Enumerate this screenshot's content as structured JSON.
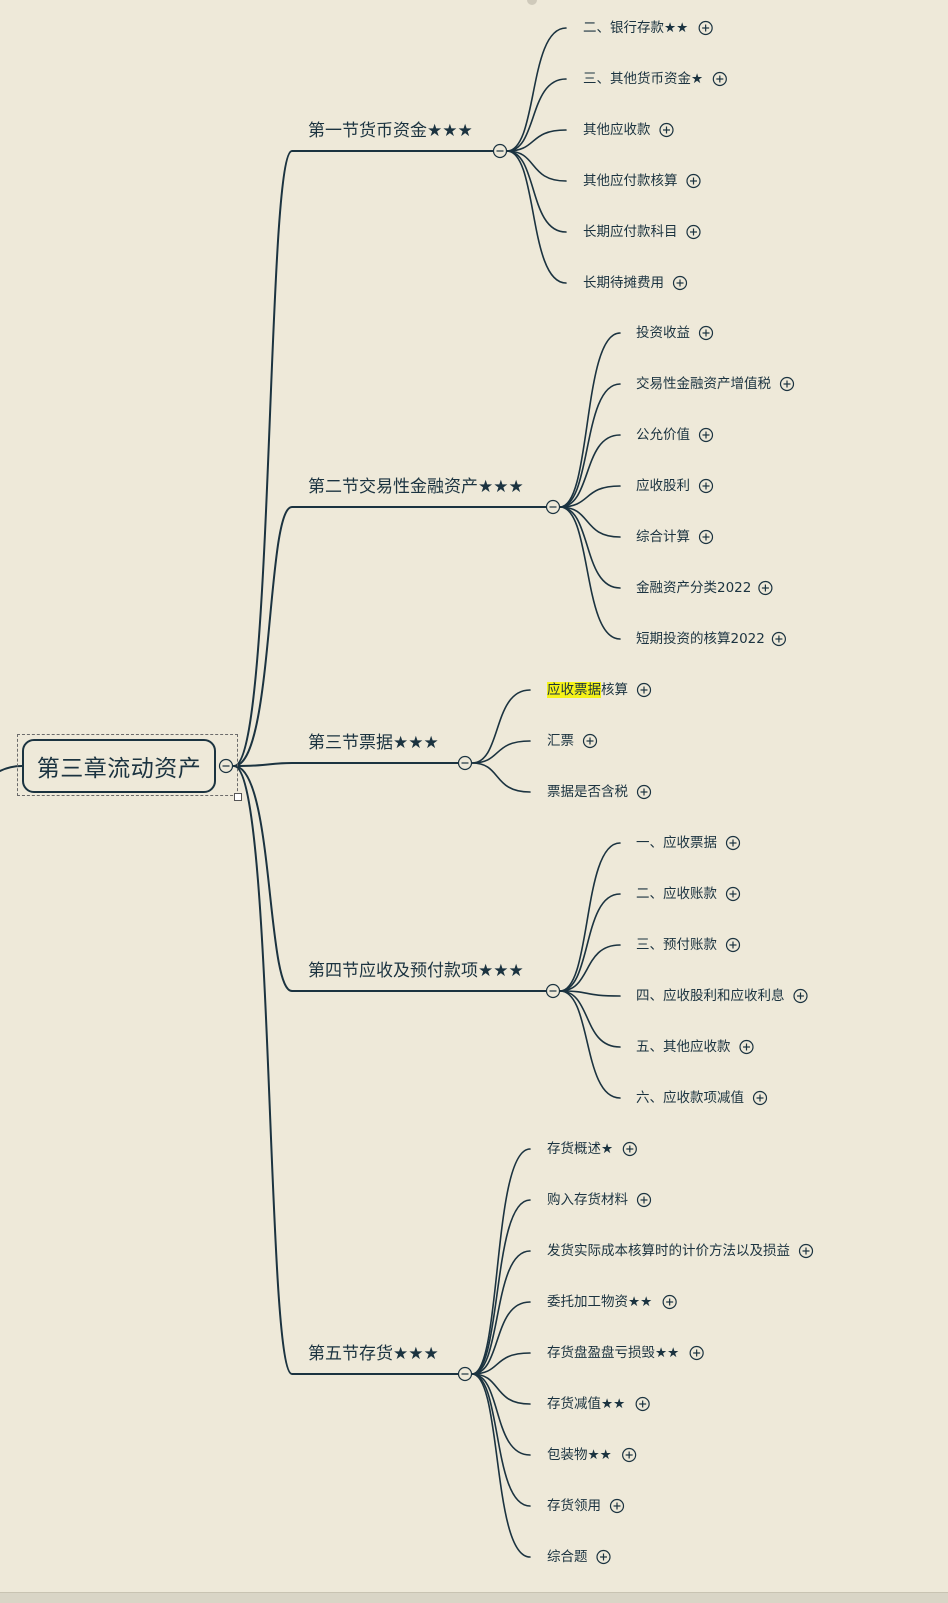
{
  "root": {
    "label": "第三章流动资产"
  },
  "sections": [
    {
      "label": "第一节货币资金★★★",
      "hl": "",
      "children": [
        {
          "label": "二、银行存款★★"
        },
        {
          "label": "三、其他货币资金★"
        },
        {
          "label": "其他应收款"
        },
        {
          "label": "其他应付款核算"
        },
        {
          "label": "长期应付款科目"
        },
        {
          "label": "长期待摊费用"
        }
      ]
    },
    {
      "label": "第二节交易性金融资产★★★",
      "children": [
        {
          "label": "投资收益"
        },
        {
          "label": "交易性金融资产增值税"
        },
        {
          "label": "公允价值"
        },
        {
          "label": "应收股利"
        },
        {
          "label": "综合计算"
        },
        {
          "label": "金融资产分类2022"
        },
        {
          "label": "短期投资的核算2022"
        }
      ]
    },
    {
      "label": "第三节票据★★★",
      "children": [
        {
          "label": "核算",
          "highlight": "应收票据"
        },
        {
          "label": "汇票"
        },
        {
          "label": "票据是否含税"
        }
      ]
    },
    {
      "label": "第四节应收及预付款项★★★",
      "children": [
        {
          "label": "一、应收票据"
        },
        {
          "label": "二、应收账款"
        },
        {
          "label": "三、预付账款"
        },
        {
          "label": "四、应收股利和应收利息"
        },
        {
          "label": "五、其他应收款"
        },
        {
          "label": "六、应收款项减值"
        }
      ]
    },
    {
      "label": "第五节存货★★★",
      "children": [
        {
          "label": "存货概述★"
        },
        {
          "label": "购入存货材料"
        },
        {
          "label": "发货实际成本核算时的计价方法以及损益"
        },
        {
          "label": "委托加工物资★★"
        },
        {
          "label": "存货盘盈盘亏损毁★★"
        },
        {
          "label": "存货减值★★"
        },
        {
          "label": "包装物★★"
        },
        {
          "label": "存货领用"
        },
        {
          "label": "综合题"
        }
      ]
    }
  ],
  "colors": {
    "line": "#1b3340",
    "background": "#eee9d9",
    "highlight": "#f5f21a"
  },
  "icons": {
    "collapse": "minus-circle-icon",
    "expand": "plus-circle-icon"
  }
}
